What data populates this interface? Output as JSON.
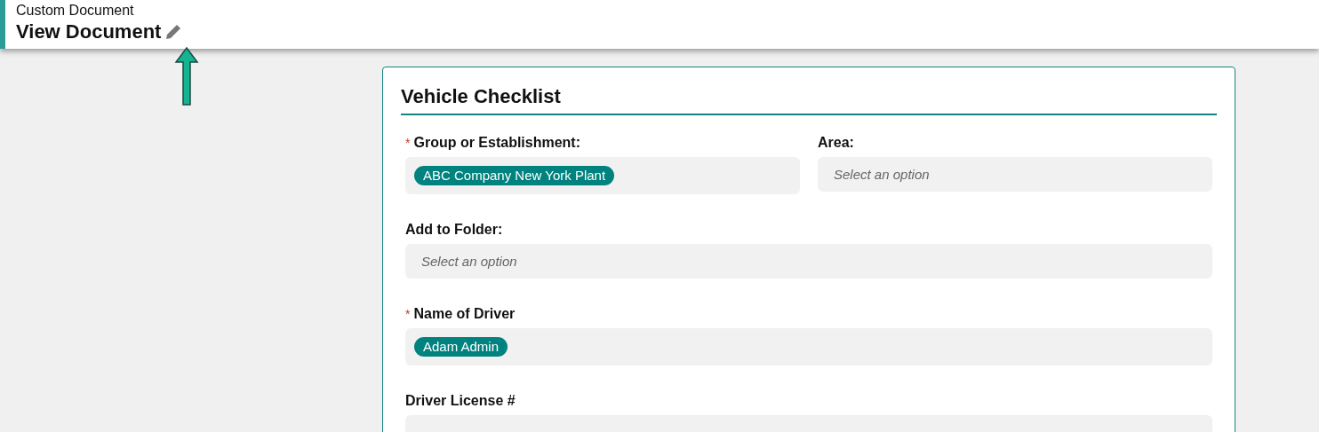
{
  "header": {
    "subtitle": "Custom Document",
    "title": "View Document"
  },
  "form": {
    "title": "Vehicle Checklist",
    "rows": [
      [
        {
          "label": "Group or Establishment:",
          "required_mark": "*",
          "kind": "chips",
          "chips": [
            "ABC Company New York Plant"
          ]
        },
        {
          "label": "Area:",
          "kind": "select",
          "placeholder": "Select an option"
        }
      ],
      [
        {
          "label": "Add to Folder:",
          "kind": "select",
          "placeholder": "Select an option"
        }
      ],
      [
        {
          "label": "Name of Driver",
          "required_mark": "*",
          "kind": "chips",
          "chips": [
            "Adam Admin"
          ]
        }
      ],
      [
        {
          "label": "Driver License #",
          "kind": "text"
        }
      ]
    ]
  }
}
